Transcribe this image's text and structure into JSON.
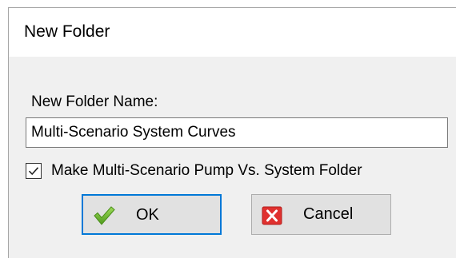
{
  "dialog": {
    "title": "New Folder",
    "field_label": "New Folder Name:",
    "name_value": "Multi-Scenario System Curves",
    "checkbox": {
      "label": "Make Multi-Scenario Pump Vs. System Folder",
      "checked": true,
      "icon": "checkmark-icon"
    },
    "ok_button": {
      "label": "OK",
      "icon": "green-check-icon",
      "accent": "#0078d7"
    },
    "cancel_button": {
      "label": "Cancel",
      "icon": "red-x-icon",
      "color": "#e0312f"
    }
  }
}
